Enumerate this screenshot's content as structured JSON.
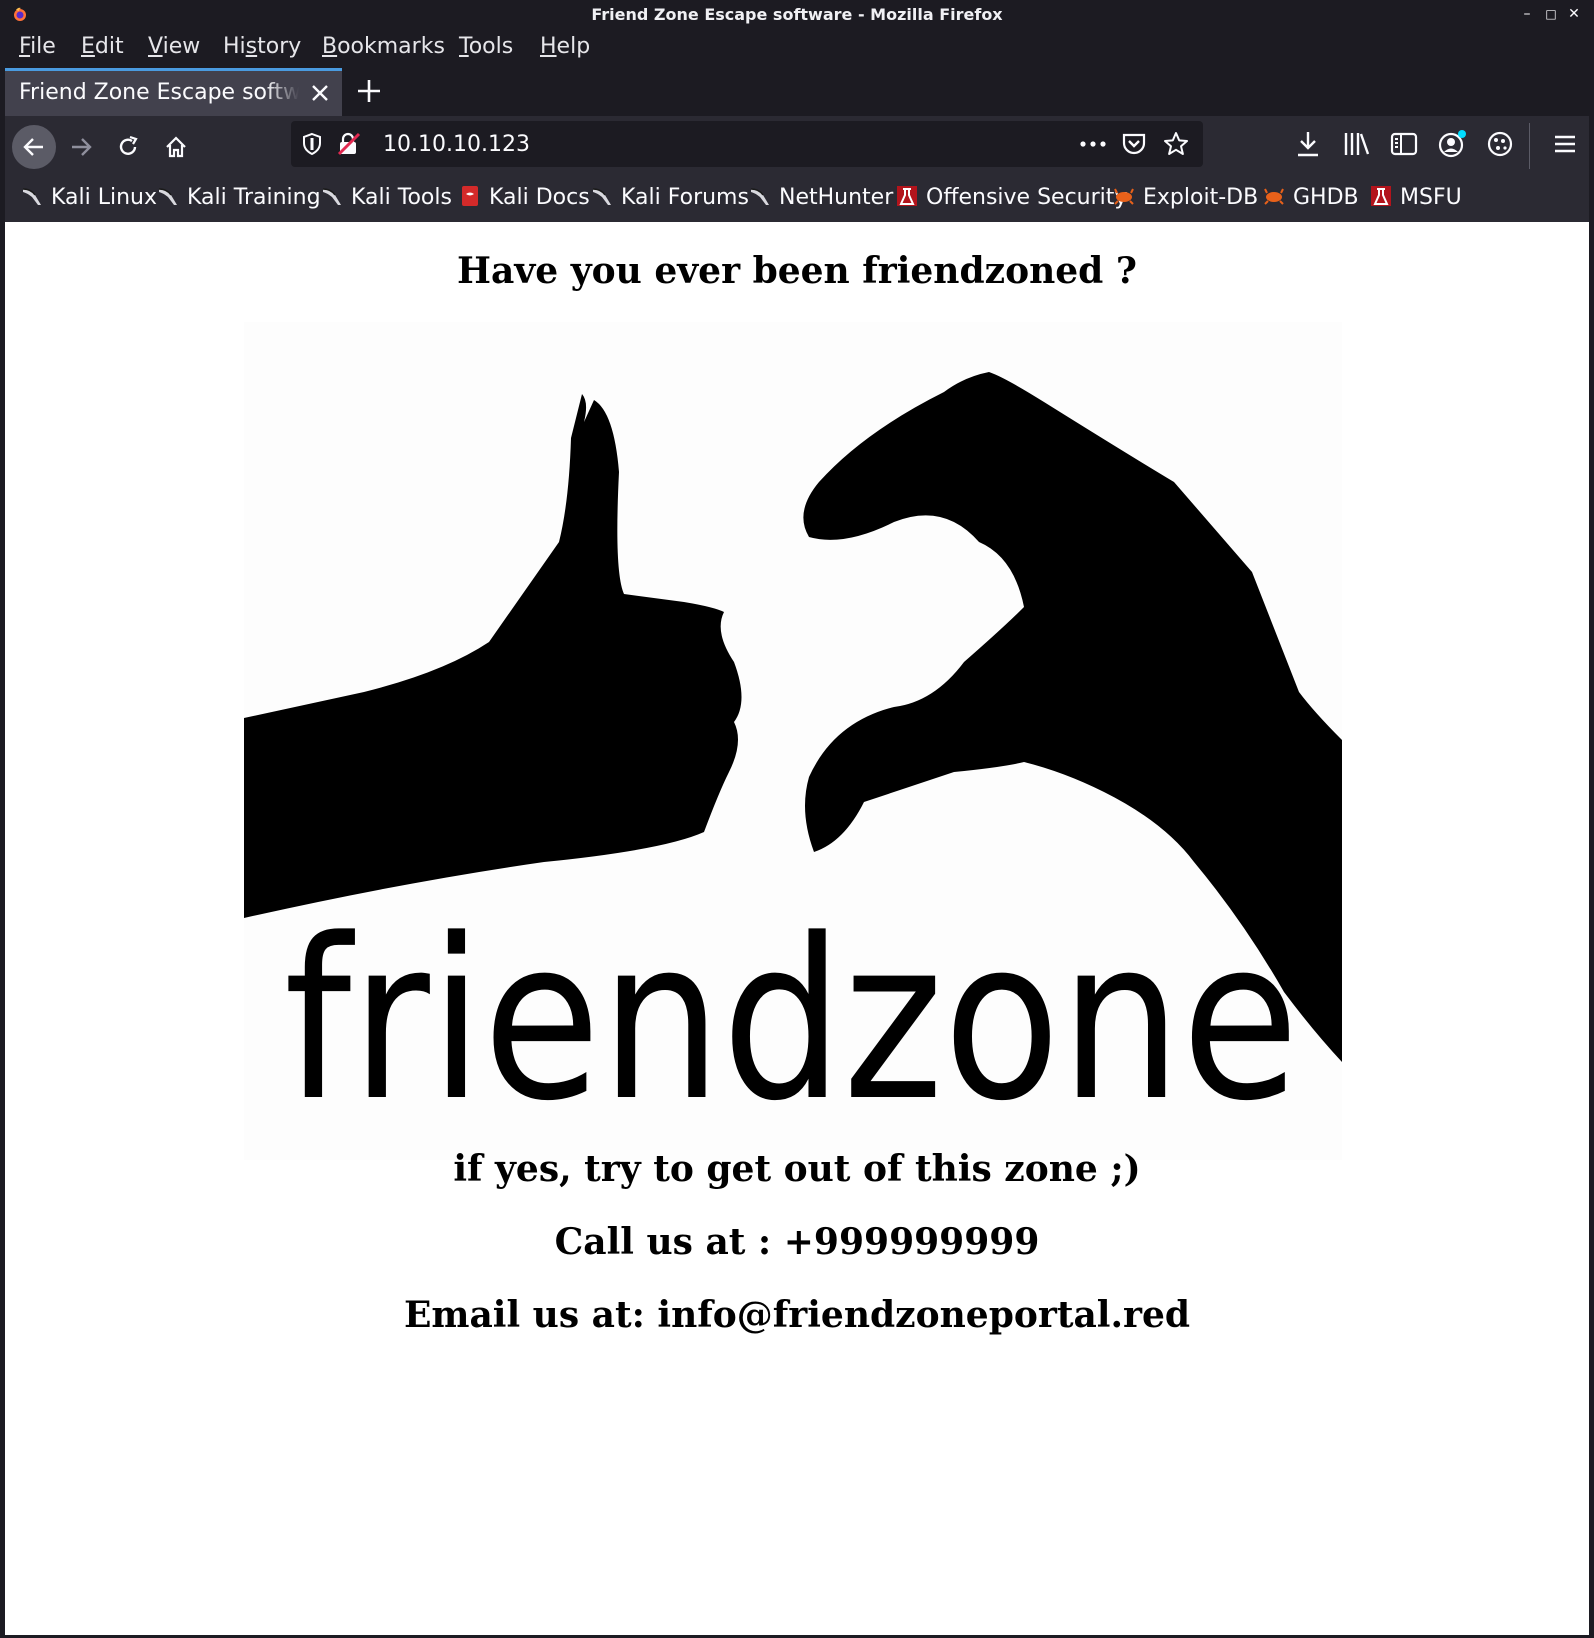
{
  "window": {
    "title": "Friend Zone Escape software - Mozilla Firefox",
    "controls": {
      "minimize": "–",
      "maximize": "□",
      "close": "✕"
    }
  },
  "menu": [
    {
      "label": "File",
      "mnemonic": "F",
      "rest": "ile"
    },
    {
      "label": "Edit",
      "mnemonic": "E",
      "rest": "dit"
    },
    {
      "label": "View",
      "mnemonic": "V",
      "rest": "iew"
    },
    {
      "label": "History",
      "pre": "Hi",
      "mnemonic": "s",
      "rest": "tory"
    },
    {
      "label": "Bookmarks",
      "mnemonic": "B",
      "rest": "ookmarks"
    },
    {
      "label": "Tools",
      "mnemonic": "T",
      "rest": "ools"
    },
    {
      "label": "Help",
      "mnemonic": "H",
      "rest": "elp"
    }
  ],
  "tab": {
    "title": "Friend Zone Escape software"
  },
  "address": {
    "url": "10.10.10.123"
  },
  "icons": {
    "back": "back-arrow-icon",
    "forward": "forward-arrow-icon",
    "reload": "reload-icon",
    "home": "home-icon",
    "tracking": "shield-icon",
    "insecure": "insecure-lock-icon",
    "page_actions": "more-icon",
    "pocket": "pocket-icon",
    "bookmark_star": "star-icon",
    "downloads": "download-icon",
    "library": "library-icon",
    "sidebar": "sidebar-icon",
    "account": "account-icon",
    "extensions": "extensions-icon",
    "app_menu": "hamburger-menu-icon"
  },
  "bookmarks": [
    {
      "label": "Kali Linux",
      "icon": "kali-dragon-icon"
    },
    {
      "label": "Kali Training",
      "icon": "kali-dragon-icon"
    },
    {
      "label": "Kali Tools",
      "icon": "kali-dragon-icon"
    },
    {
      "label": "Kali Docs",
      "icon": "kali-docs-icon"
    },
    {
      "label": "Kali Forums",
      "icon": "kali-dragon-icon"
    },
    {
      "label": "NetHunter",
      "icon": "kali-dragon-icon"
    },
    {
      "label": "Offensive Security",
      "icon": "offsec-icon"
    },
    {
      "label": "Exploit-DB",
      "icon": "exploitdb-icon"
    },
    {
      "label": "GHDB",
      "icon": "exploitdb-icon"
    },
    {
      "label": "MSFU",
      "icon": "offsec-icon"
    }
  ],
  "colors": {
    "accent": "#4a9be0",
    "chrome_dark": "#1c1b22",
    "toolbar": "#2b2a33",
    "tab_active": "#42414d",
    "page_bg": "#ffffff",
    "offsec_red": "#b3141c",
    "exploitdb_orange": "#e8611a"
  },
  "page": {
    "heading": "Have you ever been friendzoned ?",
    "logo_text": "friendzone",
    "line1": "if yes, try to get out of this zone ;)",
    "line2": "Call us at : +999999999",
    "line3": "Email us at: info@friendzoneportal.red"
  }
}
